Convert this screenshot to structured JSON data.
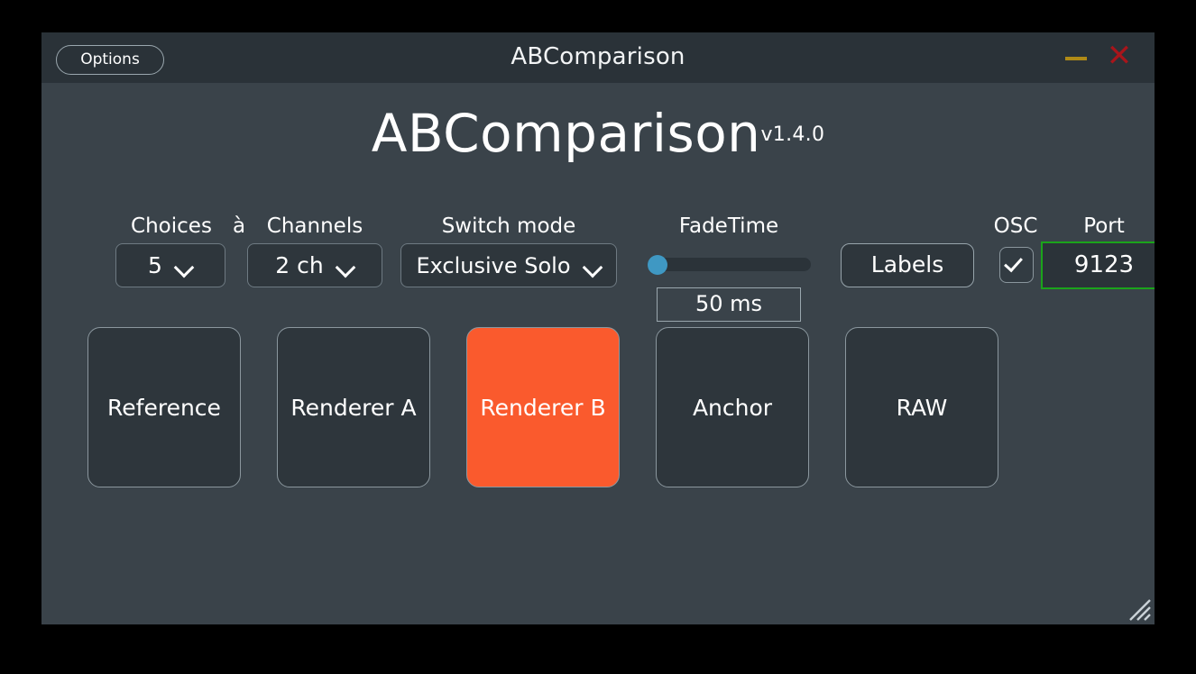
{
  "window": {
    "titlebar_title": "ABComparison",
    "options_label": "Options",
    "minimize_icon": "minimize-icon",
    "close_icon": "close-icon",
    "resize_grip_icon": "resize-grip-icon"
  },
  "heading": {
    "name": "ABComparison",
    "version": "v1.4.0"
  },
  "controls": {
    "choices": {
      "label": "Choices",
      "value": "5"
    },
    "separator": "à",
    "channels": {
      "label": "Channels",
      "value": "2 ch"
    },
    "switch_mode": {
      "label": "Switch mode",
      "value": "Exclusive Solo"
    },
    "fade_time": {
      "label": "FadeTime",
      "value": "50 ms",
      "slider_percent": 0
    },
    "labels_button": {
      "label": "Labels"
    },
    "osc": {
      "label": "OSC",
      "checked": true,
      "check_icon": "check-icon"
    },
    "port": {
      "label": "Port",
      "value": "9123",
      "border_color": "#1ba31b"
    }
  },
  "choice_buttons": [
    {
      "label": "Reference",
      "active": false
    },
    {
      "label": "Renderer A",
      "active": false
    },
    {
      "label": "Renderer B",
      "active": true
    },
    {
      "label": "Anchor",
      "active": false
    },
    {
      "label": "RAW",
      "active": false
    }
  ],
  "colors": {
    "active_button": "#fa5a2d",
    "window_body": "#3a434a",
    "titlebar": "#2a3238",
    "slider_thumb": "#3f98c3",
    "port_border": "#1ba31b",
    "minimize": "#b08a16",
    "close": "#a8151b"
  }
}
